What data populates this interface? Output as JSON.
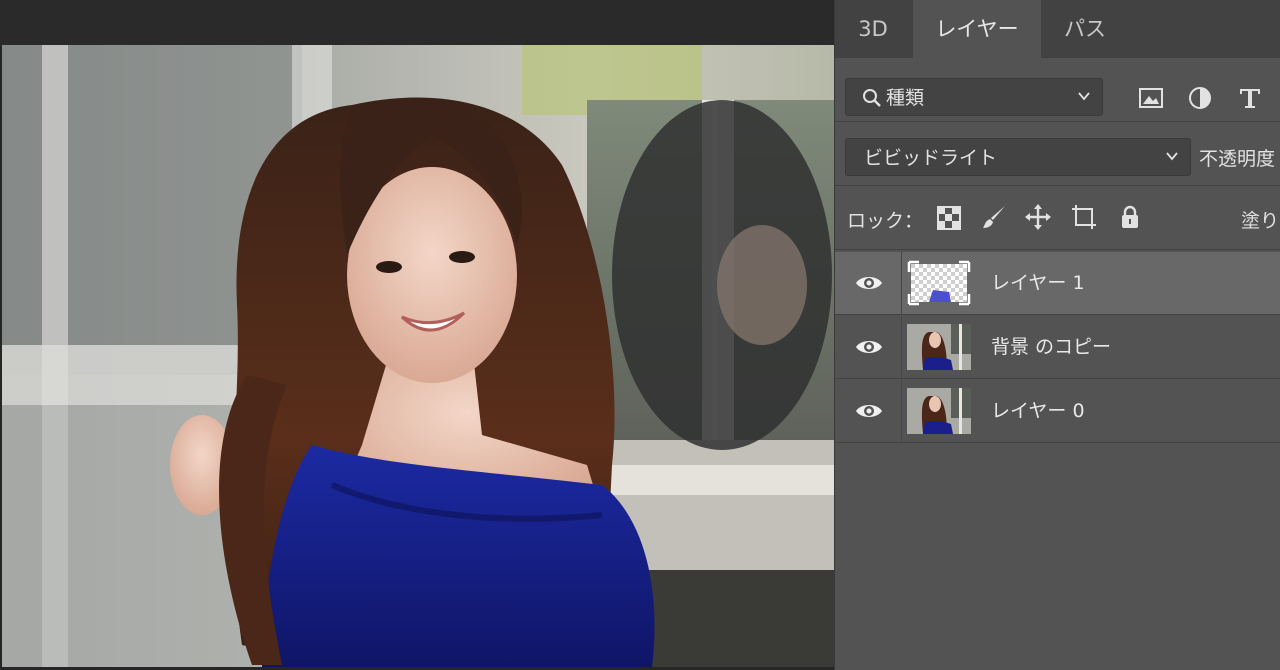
{
  "panel": {
    "tabs": [
      {
        "label": "3D",
        "active": false
      },
      {
        "label": "レイヤー",
        "active": true
      },
      {
        "label": "パス",
        "active": false
      }
    ],
    "filter": {
      "label": "種類",
      "icons": [
        "image-filter-icon",
        "adjustment-filter-icon",
        "type-filter-icon"
      ]
    },
    "blend": {
      "mode": "ビビッドライト",
      "opacity_label": "不透明度"
    },
    "lock": {
      "label": "ロック：",
      "fill_label": "塗り",
      "icons": [
        "lock-transparent-pixels-icon",
        "lock-image-pixels-icon",
        "lock-position-icon",
        "lock-artboard-icon",
        "lock-all-icon"
      ]
    },
    "layers": [
      {
        "name": "レイヤー 1",
        "visible": true,
        "selected": true,
        "thumb": "transparent-with-blue"
      },
      {
        "name": "背景 のコピー",
        "visible": true,
        "selected": false,
        "thumb": "photo"
      },
      {
        "name": "レイヤー 0",
        "visible": true,
        "selected": false,
        "thumb": "photo"
      }
    ]
  },
  "colors": {
    "panel_bg": "#535353",
    "tabbar_bg": "#424242",
    "selected_layer_bg": "#686868",
    "dress_blue": "#1a1f8c",
    "text": "#e2e2e2"
  }
}
